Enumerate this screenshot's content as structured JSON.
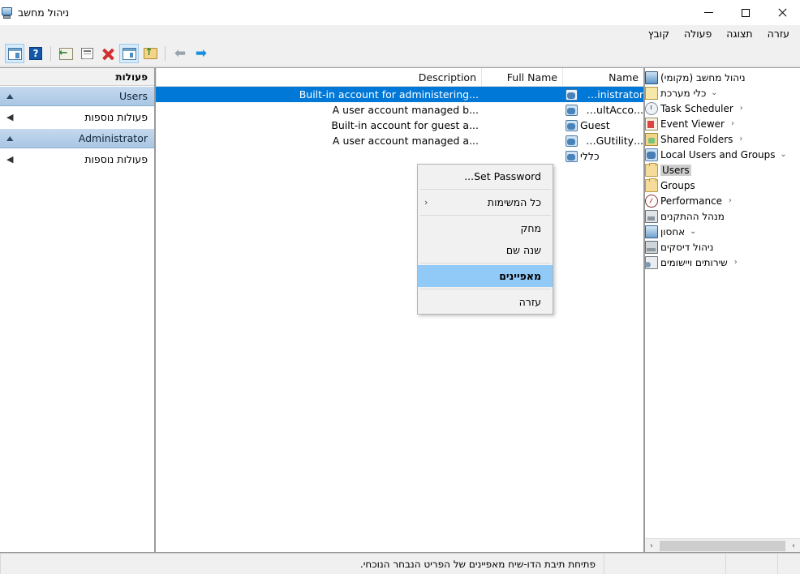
{
  "window": {
    "title": "ניהול מחשב",
    "icon": "computer-management-icon",
    "controls": {
      "minimize": "−",
      "maximize": "□",
      "close": "✕"
    }
  },
  "menubar": {
    "items": [
      {
        "label": "קובץ",
        "name": "menu-file"
      },
      {
        "label": "פעולה",
        "name": "menu-action"
      },
      {
        "label": "תצוגה",
        "name": "menu-view"
      },
      {
        "label": "עזרה",
        "name": "menu-help"
      }
    ]
  },
  "toolbar": {
    "buttons": [
      {
        "name": "show-hide-console-tree-button",
        "icon": "window-list-icon",
        "active": true
      },
      {
        "name": "help-button",
        "icon": "question-mark-icon",
        "label": "?"
      },
      {
        "name": "export-list-button",
        "icon": "export-icon"
      },
      {
        "name": "properties-button",
        "icon": "properties-icon"
      },
      {
        "name": "delete-button",
        "icon": "red-x-icon"
      },
      {
        "name": "show-details-button",
        "icon": "detail-pane-icon",
        "active": true
      },
      {
        "name": "up-one-level-button",
        "icon": "folder-up-icon"
      },
      {
        "name": "back-button",
        "icon": "left-arrow-icon",
        "glyph": "⬅"
      },
      {
        "name": "forward-button",
        "icon": "right-arrow-icon",
        "glyph": "➡"
      }
    ]
  },
  "tree": {
    "nodes": [
      {
        "label": "ניהול מחשב (מקומי)",
        "icon": "computer-icon",
        "indent": 0,
        "chevron": "",
        "selected": false,
        "name": "tree-node-computer-management"
      },
      {
        "label": "כלי מערכת",
        "icon": "tools-icon",
        "indent": 1,
        "chevron": "⌄",
        "selected": false,
        "name": "tree-node-system-tools"
      },
      {
        "label": "Task Scheduler",
        "icon": "clock-icon",
        "indent": 2,
        "chevron": "‹",
        "selected": false,
        "name": "tree-node-task-scheduler"
      },
      {
        "label": "Event Viewer",
        "icon": "event-viewer-icon",
        "indent": 2,
        "chevron": "‹",
        "selected": false,
        "name": "tree-node-event-viewer"
      },
      {
        "label": "Shared Folders",
        "icon": "shared-folders-icon",
        "indent": 2,
        "chevron": "‹",
        "selected": false,
        "name": "tree-node-shared-folders"
      },
      {
        "label": "Local Users and Groups",
        "icon": "users-groups-icon",
        "indent": 2,
        "chevron": "⌄",
        "selected": false,
        "name": "tree-node-local-users-and-groups"
      },
      {
        "label": "Users",
        "icon": "folder-icon",
        "indent": 3,
        "chevron": "",
        "selected": true,
        "name": "tree-node-users"
      },
      {
        "label": "Groups",
        "icon": "folder-icon",
        "indent": 3,
        "chevron": "",
        "selected": false,
        "name": "tree-node-groups"
      },
      {
        "label": "Performance",
        "icon": "performance-icon",
        "indent": 2,
        "chevron": "‹",
        "selected": false,
        "name": "tree-node-performance"
      },
      {
        "label": "מנהל ההתקנים",
        "icon": "device-manager-icon",
        "indent": 2,
        "chevron": "",
        "selected": false,
        "name": "tree-node-device-manager"
      },
      {
        "label": "אחסון",
        "icon": "storage-icon",
        "indent": 1,
        "chevron": "⌄",
        "selected": false,
        "name": "tree-node-storage"
      },
      {
        "label": "ניהול דיסקים",
        "icon": "disk-management-icon",
        "indent": 2,
        "chevron": "",
        "selected": false,
        "name": "tree-node-disk-management"
      },
      {
        "label": "שירותים ויישומים",
        "icon": "services-icon",
        "indent": 1,
        "chevron": "‹",
        "selected": false,
        "name": "tree-node-services-and-applications"
      }
    ],
    "hscroll": {
      "left_arrow": "‹",
      "right_arrow": "›"
    }
  },
  "list": {
    "columns": [
      {
        "label": "Name",
        "name": "column-header-name"
      },
      {
        "label": "Full Name",
        "name": "column-header-full-name"
      },
      {
        "label": "Description",
        "name": "column-header-description"
      }
    ],
    "rows": [
      {
        "name": "Administrator",
        "full_name": "",
        "description": "...Built-in account for administering",
        "selected": true
      },
      {
        "name": "...DefaultAcco",
        "full_name": "",
        "description": "...A user account managed b",
        "selected": false
      },
      {
        "name": "Guest",
        "full_name": "",
        "description": "...Built-in account for guest a",
        "selected": false
      },
      {
        "name": "...WDAGUtility",
        "full_name": "",
        "description": "...A user account managed a",
        "selected": false
      },
      {
        "name": "כללי",
        "full_name": "",
        "description": "",
        "selected": false
      }
    ]
  },
  "context_menu": {
    "items": [
      {
        "label": "Set Password...",
        "submenu": "",
        "highlighted": false,
        "name": "context-menu-set-password"
      },
      {
        "label": "כל המשימות",
        "submenu": "‹",
        "highlighted": false,
        "name": "context-menu-all-tasks"
      },
      {
        "label": "מחק",
        "submenu": "",
        "highlighted": false,
        "name": "context-menu-delete"
      },
      {
        "label": "שנה שם",
        "submenu": "",
        "highlighted": false,
        "name": "context-menu-rename"
      },
      {
        "label": "מאפיינים",
        "submenu": "",
        "highlighted": true,
        "name": "context-menu-properties"
      },
      {
        "label": "עזרה",
        "submenu": "",
        "highlighted": false,
        "name": "context-menu-help"
      }
    ]
  },
  "actions_pane": {
    "title": "פעולות",
    "groups": [
      {
        "label": "Users",
        "collapse": "▲",
        "item": "פעולות נוספות",
        "item_arrow": "◀"
      },
      {
        "label": "Administrator",
        "collapse": "▲",
        "item": "פעולות נוספות",
        "item_arrow": "◀"
      }
    ]
  },
  "statusbar": {
    "message": "פתיחת תיבת הדו-שיח מאפיינים של הפריט הנבחר הנוכחי."
  },
  "colors": {
    "selection_blue": "#0078d7",
    "menu_highlight": "#91c9f7",
    "group_header": "#a9c6e4"
  }
}
